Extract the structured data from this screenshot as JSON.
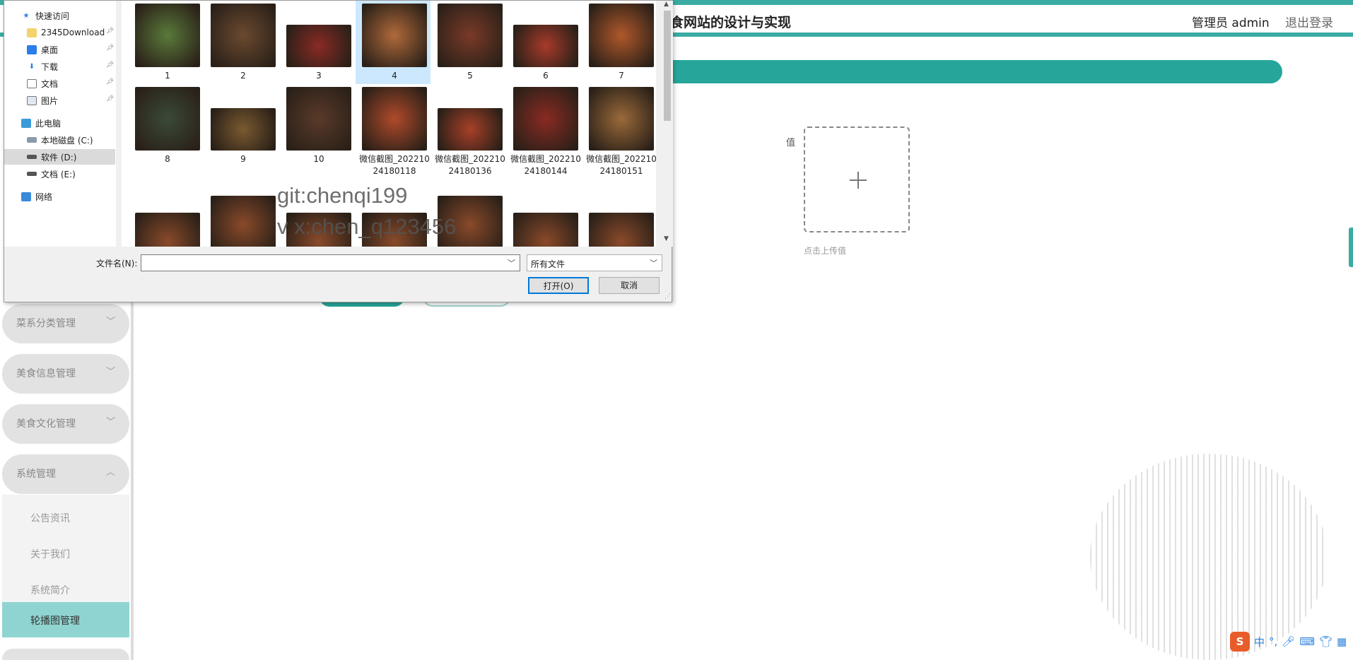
{
  "app": {
    "title": "食网站的设计与实现",
    "user_label": "管理员 admin",
    "logout_label": "退出登录"
  },
  "form": {
    "field_label": "值",
    "upload_hint": "点击上传值"
  },
  "sidebar": {
    "items": [
      {
        "label": "菜系分类管理",
        "chevron": "﹀"
      },
      {
        "label": "美食信息管理",
        "chevron": "﹀"
      },
      {
        "label": "美食文化管理",
        "chevron": "﹀"
      },
      {
        "label": "系统管理",
        "chevron": "︿"
      }
    ],
    "subitems": [
      {
        "label": "公告资讯"
      },
      {
        "label": "关于我们"
      },
      {
        "label": "系统简介"
      },
      {
        "label": "轮播图管理"
      }
    ]
  },
  "dialog": {
    "nav": {
      "quick_access": "快速访问",
      "downloads_2345": "2345Download",
      "desktop": "桌面",
      "downloads": "下载",
      "documents": "文档",
      "pictures": "图片",
      "this_pc": "此电脑",
      "drive_c": "本地磁盘 (C:)",
      "drive_d": "软件 (D:)",
      "drive_e": "文档 (E:)",
      "network": "网络"
    },
    "files": [
      {
        "name": "1",
        "color": "#5a7a3a"
      },
      {
        "name": "2",
        "color": "#6b4a30"
      },
      {
        "name": "3",
        "color": "#8a2a24"
      },
      {
        "name": "4",
        "color": "#b06a3a"
      },
      {
        "name": "5",
        "color": "#7a3a28"
      },
      {
        "name": "6",
        "color": "#a83a2a"
      },
      {
        "name": "7",
        "color": "#b0582a"
      },
      {
        "name": "8",
        "color": "#3a4a3a"
      },
      {
        "name": "9",
        "color": "#7a5a30"
      },
      {
        "name": "10",
        "color": "#5a3a2a"
      },
      {
        "name": "微信截图_20221024180118",
        "color": "#b04a2a"
      },
      {
        "name": "微信截图_20221024180136",
        "color": "#a84028"
      },
      {
        "name": "微信截图_20221024180144",
        "color": "#8a2a22"
      },
      {
        "name": "微信截图_20221024180151",
        "color": "#9a6a3a"
      }
    ],
    "watermark": [
      "git:chenqi199",
      "v x:chen_q123456"
    ],
    "filename_label": "文件名(N):",
    "filename_value": "",
    "filetype": "所有文件",
    "open_label": "打开(O)",
    "cancel_label": "取消"
  },
  "tray": {
    "ime": "中",
    "punct": "°,"
  }
}
